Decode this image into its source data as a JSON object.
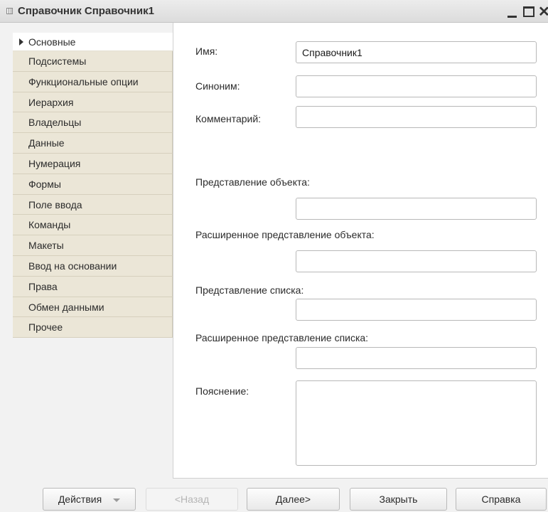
{
  "window": {
    "title": "Справочник Справочник1",
    "close_glyph": "✕"
  },
  "tabs": [
    {
      "label": "Основные",
      "active": true
    },
    {
      "label": "Подсистемы"
    },
    {
      "label": "Функциональные опции"
    },
    {
      "label": "Иерархия"
    },
    {
      "label": "Владельцы"
    },
    {
      "label": "Данные"
    },
    {
      "label": "Нумерация"
    },
    {
      "label": "Формы"
    },
    {
      "label": "Поле ввода"
    },
    {
      "label": "Команды"
    },
    {
      "label": "Макеты"
    },
    {
      "label": "Ввод на основании"
    },
    {
      "label": "Права"
    },
    {
      "label": "Обмен данными"
    },
    {
      "label": "Прочее"
    }
  ],
  "form": {
    "name_label": "Имя:",
    "name_value": "Справочник1",
    "synonym_label": "Синоним:",
    "synonym_value": "",
    "comment_label": "Комментарий:",
    "comment_value": "",
    "object_presentation_label": "Представление объекта:",
    "object_presentation_value": "",
    "ext_object_presentation_label": "Расширенное представление объекта:",
    "ext_object_presentation_value": "",
    "list_presentation_label": "Представление списка:",
    "list_presentation_value": "",
    "ext_list_presentation_label": "Расширенное представление списка:",
    "ext_list_presentation_value": "",
    "explanation_label": "Пояснение:",
    "explanation_value": ""
  },
  "buttons": {
    "actions": "Действия",
    "back": "<Назад",
    "next": "Далее>",
    "close": "Закрыть",
    "help": "Справка"
  }
}
